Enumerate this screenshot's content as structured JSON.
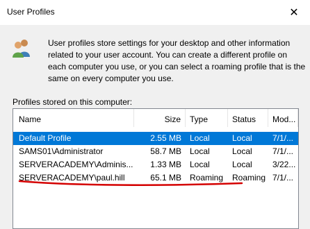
{
  "window": {
    "title": "User Profiles",
    "close_glyph": "✕"
  },
  "description": "User profiles store settings for your desktop and other information related to your user account. You can create a different profile on each computer you use, or you can select a roaming profile that is the same on every computer you use.",
  "list_label": "Profiles stored on this computer:",
  "columns": [
    "Name",
    "Size",
    "Type",
    "Status",
    "Mod..."
  ],
  "rows": [
    {
      "name": "Default Profile",
      "size": "2.55 MB",
      "type": "Local",
      "status": "Local",
      "mod": "7/1/..."
    },
    {
      "name": "SAMS01\\Administrator",
      "size": "58.7 MB",
      "type": "Local",
      "status": "Local",
      "mod": "7/1/..."
    },
    {
      "name": "SERVERACADEMY\\Adminis...",
      "size": "1.33 MB",
      "type": "Local",
      "status": "Local",
      "mod": "3/22..."
    },
    {
      "name": "SERVERACADEMY\\paul.hill",
      "size": "65.1 MB",
      "type": "Roaming",
      "status": "Roaming",
      "mod": "7/1/..."
    }
  ],
  "icons": {
    "header": "users-icon"
  },
  "colors": {
    "selection": "#0078d7",
    "annotation": "#d40000"
  }
}
